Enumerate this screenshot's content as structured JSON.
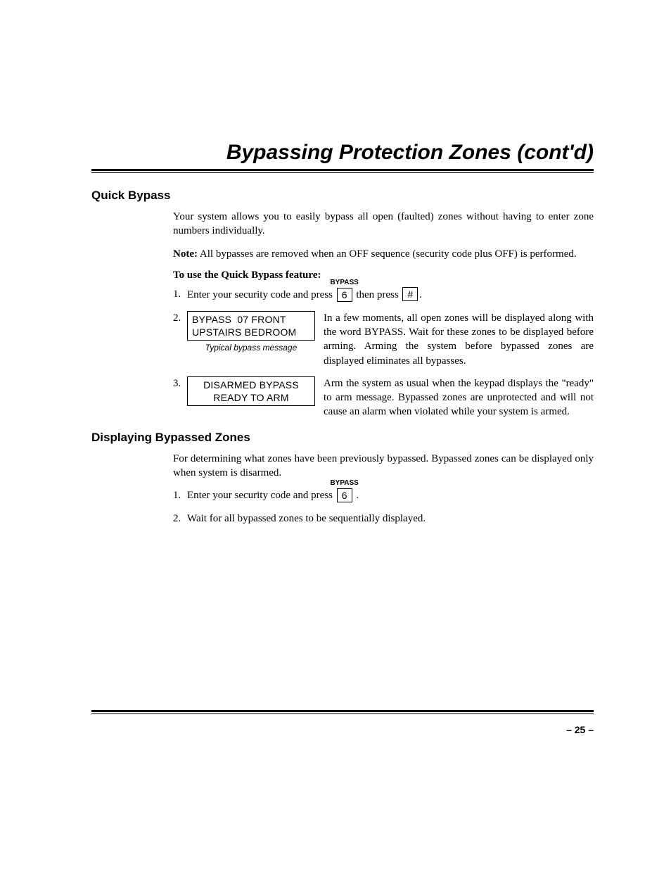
{
  "title": "Bypassing Protection Zones (cont'd)",
  "section1": {
    "heading": "Quick Bypass",
    "intro": "Your system allows you to easily bypass all open (faulted) zones without having to enter zone numbers individually.",
    "note_label": "Note:",
    "note_body": " All bypasses are removed when an OFF sequence (security code plus OFF) is performed.",
    "subhead": "To use the Quick Bypass feature:",
    "step1_pre": "Enter your security code and press ",
    "key_label": "BYPASS",
    "key6": "6",
    "step1_mid": " then press ",
    "key_pound": "#",
    "step1_post": ".",
    "step2_lcd_line1": "BYPASS  07 FRONT",
    "step2_lcd_line2": "UPSTAIRS BEDROOM",
    "step2_caption": "Typical bypass message",
    "step2_desc": "In a few moments, all open zones will be displayed along with the word BYPASS. Wait for these zones to be displayed before arming. Arming the system before bypassed zones are displayed eliminates all bypasses.",
    "step3_lcd_line1": "DISARMED BYPASS",
    "step3_lcd_line2": "READY TO ARM",
    "step3_desc": "Arm the system as usual when the keypad displays the \"ready\" to arm message. Bypassed zones are unprotected and will not cause an alarm when violated while your system is armed."
  },
  "section2": {
    "heading": "Displaying Bypassed Zones",
    "intro": "For determining what zones have been previously bypassed. Bypassed zones can be displayed only when system is disarmed.",
    "step1_pre": "Enter your security code and press ",
    "key_label": "BYPASS",
    "key6": "6",
    "step1_post": " .",
    "step2": "Wait for all bypassed zones to be sequentially displayed."
  },
  "page_number": "– 25 –"
}
